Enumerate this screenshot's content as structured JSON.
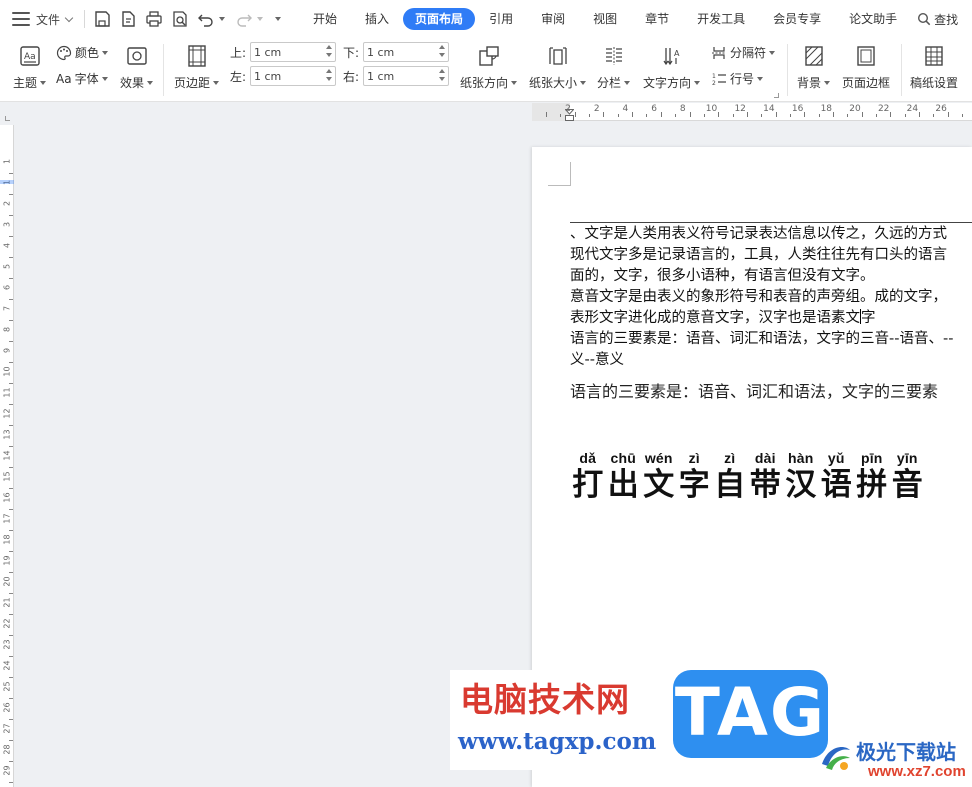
{
  "menubar": {
    "file_label": "文件",
    "tabs": [
      {
        "label": "开始",
        "active": false
      },
      {
        "label": "插入",
        "active": false
      },
      {
        "label": "页面布局",
        "active": true
      },
      {
        "label": "引用",
        "active": false
      },
      {
        "label": "审阅",
        "active": false
      },
      {
        "label": "视图",
        "active": false
      },
      {
        "label": "章节",
        "active": false
      },
      {
        "label": "开发工具",
        "active": false
      },
      {
        "label": "会员专享",
        "active": false
      },
      {
        "label": "论文助手",
        "active": false
      }
    ],
    "search_label": "查找",
    "accent_color": "#2f7cf6"
  },
  "ribbon": {
    "theme_label": "主题",
    "color_label": "颜色",
    "font_label": "字体",
    "effect_label": "效果",
    "margin_label": "页边距",
    "top_label": "上:",
    "bottom_label": "下:",
    "left_label": "左:",
    "right_label": "右:",
    "top_value": "1 cm",
    "bottom_value": "1 cm",
    "left_value": "1 cm",
    "right_value": "1 cm",
    "orientation_label": "纸张方向",
    "size_label": "纸张大小",
    "columns_label": "分栏",
    "text_direction_label": "文字方向",
    "separator_label": "分隔符",
    "line_number_label": "行号",
    "background_label": "背景",
    "page_border_label": "页面边框",
    "manuscript_label": "稿纸设置"
  },
  "rulers": {
    "h_numbers": [
      "2",
      "2",
      "4",
      "6",
      "8",
      "10",
      "12",
      "14",
      "16",
      "18",
      "20",
      "22",
      "24",
      "26",
      "28"
    ],
    "v_numbers": [
      "1",
      "1",
      "2",
      "3",
      "4",
      "5",
      "6",
      "7",
      "8",
      "9",
      "10",
      "11",
      "12",
      "13",
      "14",
      "15",
      "16",
      "17",
      "18",
      "19",
      "20",
      "21",
      "22",
      "23",
      "24",
      "25",
      "26",
      "27",
      "28",
      "29"
    ]
  },
  "document": {
    "lines": [
      "、文字是人类用表义符号记录表达信息以传之，久远的方式",
      "现代文字多是记录语言的，工具，人类往往先有口头的语言",
      "面的，文字，很多小语种，有语言但没有文字。",
      "意音文字是由表义的象形符号和表音的声旁组。成的文字，",
      "表形文字进化成的意音文字，汉字也是语素文",
      "语言的三要素是：语音、词汇和语法，文字的三音--语音、--",
      "义--意义"
    ],
    "cursor_line_tail": "字",
    "serif_line": "语言的三要素是：语音、词汇和语法，文字的三要素",
    "pinyin_title": [
      {
        "py": "dǎ",
        "hz": "打"
      },
      {
        "py": "chū",
        "hz": "出"
      },
      {
        "py": "wén",
        "hz": "文"
      },
      {
        "py": "zì",
        "hz": "字"
      },
      {
        "py": "zì",
        "hz": "自"
      },
      {
        "py": "dài",
        "hz": "带"
      },
      {
        "py": "hàn",
        "hz": "汉"
      },
      {
        "py": "yǔ",
        "hz": "语"
      },
      {
        "py": "pīn",
        "hz": "拼"
      },
      {
        "py": "yīn",
        "hz": "音"
      }
    ]
  },
  "watermarks": {
    "site_name": "电脑技术网",
    "site_url": "www.tagxp.com",
    "tag_text": "TAG",
    "brand_name": "极光下载站",
    "brand_url": "www.xz7.com"
  }
}
